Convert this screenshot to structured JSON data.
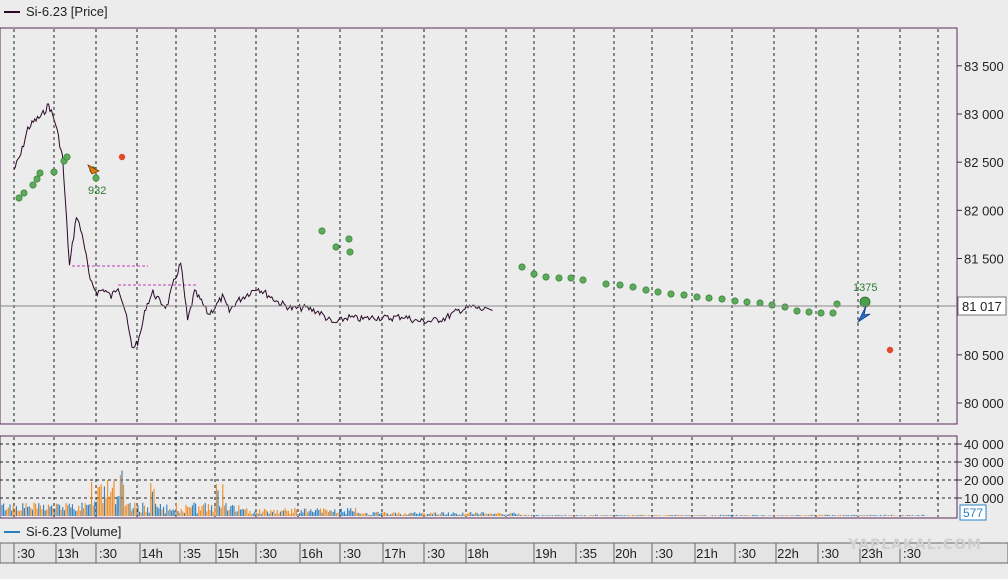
{
  "price_panel": {
    "legend": "Si-6.23 [Price]",
    "line_color": "#2a0a2a",
    "last_price_label": "81 017",
    "last_price": 81017
  },
  "volume_panel": {
    "legend": "Si-6.23 [Volume]",
    "last_volume_label": "577",
    "buy_color": "#2a7fc0",
    "sell_color": "#f08a1e"
  },
  "watermark": "YAPLAKAL.COM",
  "chart_data": [
    {
      "type": "line",
      "panel": "price",
      "y_ticks": [
        "83 500",
        "83 000",
        "82 500",
        "82 000",
        "81 500",
        "80 500",
        "80 000"
      ],
      "y_tick_values": [
        83500,
        83000,
        82500,
        82000,
        81500,
        80500,
        80000
      ],
      "ylim": [
        79800,
        83850
      ],
      "x_time_labels": [
        ":30",
        "13h",
        ":30",
        "14h",
        ":35",
        "15h",
        ":30",
        "16h",
        ":30",
        "17h",
        ":30",
        "18h",
        "19h",
        ":35",
        "20h",
        ":30",
        "21h",
        ":30",
        "22h",
        ":30",
        "23h",
        ":30"
      ],
      "x": [
        "12:20",
        "12:30",
        "12:40",
        "12:50",
        "13:00",
        "13:10",
        "13:20",
        "13:30",
        "13:40",
        "13:50",
        "14:00",
        "14:10",
        "14:20",
        "14:30",
        "14:40",
        "14:50",
        "15:00",
        "15:10",
        "15:20",
        "15:30",
        "15:40",
        "15:50",
        "16:00",
        "16:10",
        "16:20",
        "16:30",
        "16:40",
        "16:50",
        "17:00",
        "17:10",
        "17:20",
        "17:30",
        "17:40",
        "17:50",
        "18:00",
        "18:10",
        "18:20",
        "18:40",
        "19:00",
        "19:20",
        "19:40",
        "20:00",
        "20:20",
        "20:40",
        "21:00",
        "21:20",
        "21:40",
        "22:00",
        "22:20",
        "22:40",
        "23:00",
        "23:20",
        "23:40"
      ],
      "y": [
        82420,
        82580,
        82850,
        82930,
        82980,
        83100,
        82900,
        82550,
        81420,
        81950,
        81700,
        81250,
        81150,
        81180,
        81100,
        81220,
        80960,
        80570,
        80650,
        81000,
        81150,
        81050,
        81000,
        81250,
        81450,
        80850,
        81150,
        81050,
        80920,
        81000,
        81100,
        80950,
        81050,
        81100,
        81150,
        81200,
        81150,
        81050,
        80980,
        80990,
        80940,
        80820,
        80890,
        80870,
        80890,
        80880,
        80900,
        80850,
        80850,
        80880,
        80960,
        81000,
        80960
      ],
      "markers": [
        {
          "label": "932",
          "x": "13:25",
          "y": 82330,
          "type": "sell-arrow"
        },
        {
          "label": "1375",
          "x": "23:00",
          "y": 81000,
          "type": "buy-arrow"
        }
      ]
    },
    {
      "type": "bar",
      "panel": "volume",
      "y_ticks": [
        "40 000",
        "30 000",
        "20 000",
        "10 000"
      ],
      "y_tick_values": [
        40000,
        30000,
        20000,
        10000
      ],
      "ylim": [
        0,
        42000
      ]
    }
  ]
}
